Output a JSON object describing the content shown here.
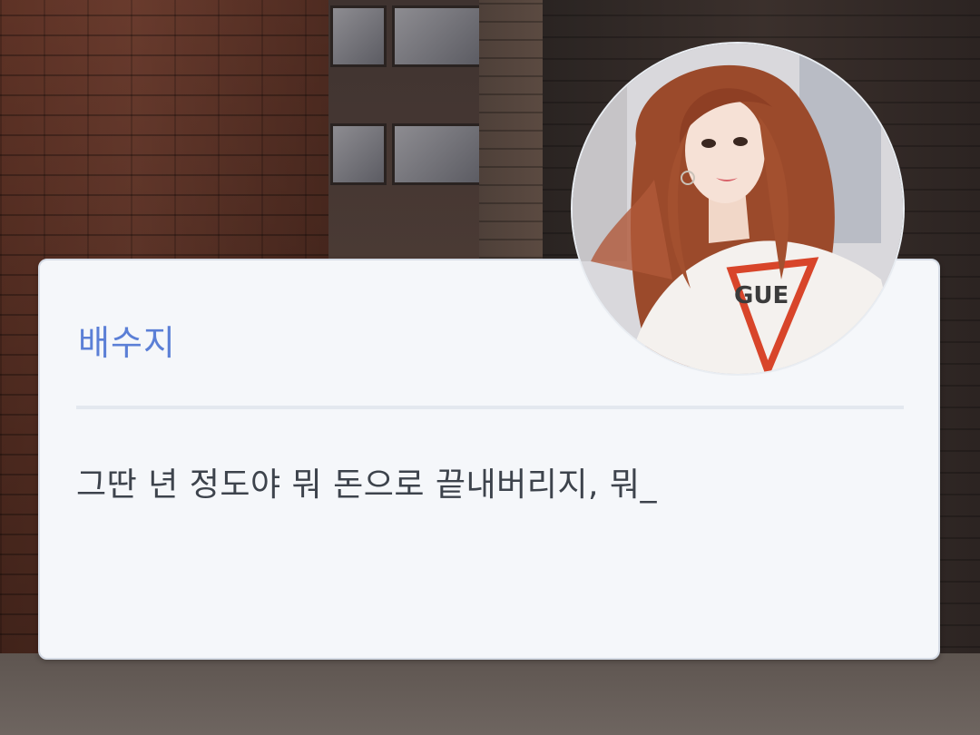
{
  "dialog": {
    "speaker": "배수지",
    "text": "그딴 년 정도야 뭐 돈으로 끝내버리지, 뭐_"
  },
  "avatar": {
    "shirt_logo": "GUE"
  },
  "colors": {
    "speaker": "#5b7fd6",
    "text": "#3d434c",
    "card": "#f5f7fa"
  }
}
